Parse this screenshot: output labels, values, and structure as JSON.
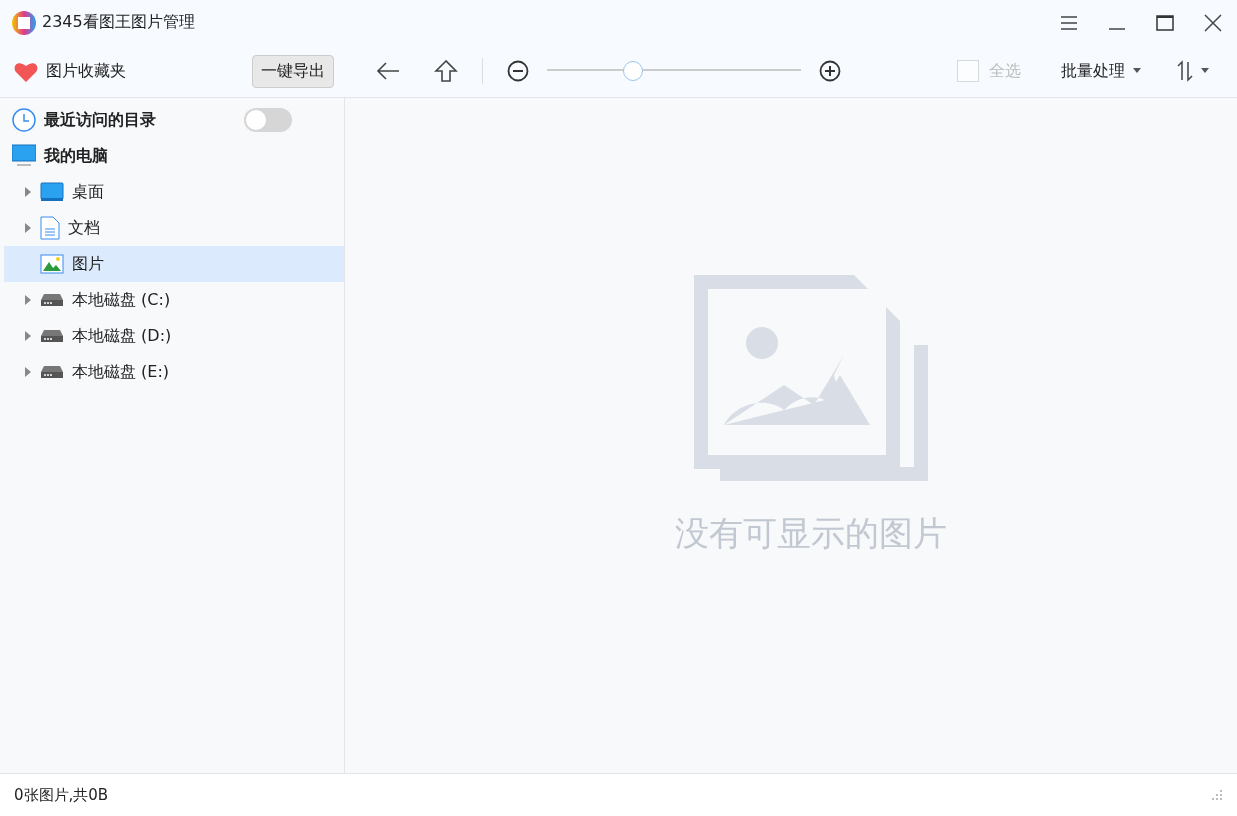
{
  "window": {
    "title": "2345看图王图片管理"
  },
  "toolbar": {
    "favorites": "图片收藏夹",
    "export_button": "一键导出",
    "zoom": {
      "level": 0.34
    },
    "select_all": {
      "label": "全选",
      "checked": false,
      "disabled": true
    },
    "batch": "批量处理"
  },
  "sidebar": {
    "recent": {
      "label": "最近访问的目录",
      "on": false
    },
    "computer": {
      "label": "我的电脑",
      "children": [
        {
          "label": "桌面",
          "kind": "desktop",
          "expandable": true,
          "selected": false
        },
        {
          "label": "文档",
          "kind": "document",
          "expandable": true,
          "selected": false
        },
        {
          "label": "图片",
          "kind": "pictures",
          "expandable": false,
          "selected": true
        },
        {
          "label": "本地磁盘 (C:)",
          "kind": "drive",
          "expandable": true,
          "selected": false
        },
        {
          "label": "本地磁盘 (D:)",
          "kind": "drive",
          "expandable": true,
          "selected": false
        },
        {
          "label": "本地磁盘 (E:)",
          "kind": "drive",
          "expandable": true,
          "selected": false
        }
      ]
    }
  },
  "empty_state": {
    "message": "没有可显示的图片"
  },
  "status_bar": {
    "text": "0张图片,共0B"
  }
}
